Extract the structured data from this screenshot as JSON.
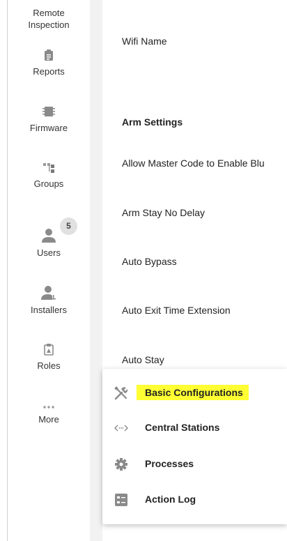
{
  "sidebar": {
    "items": [
      {
        "label_line1": "Remote",
        "label_line2": "Inspection",
        "icon": "remote-inspection-icon"
      },
      {
        "label": "Reports",
        "icon": "clipboard-icon"
      },
      {
        "label": "Firmware",
        "icon": "chip-icon"
      },
      {
        "label": "Groups",
        "icon": "groups-icon"
      },
      {
        "label": "Users",
        "icon": "user-icon",
        "badge": "5"
      },
      {
        "label": "Installers",
        "icon": "installer-icon"
      },
      {
        "label": "Roles",
        "icon": "roles-icon"
      },
      {
        "label": "More",
        "icon": "more-dots-icon"
      }
    ]
  },
  "main": {
    "wifi_name": "Wifi Name",
    "section_title": "Arm Settings",
    "settings": [
      "Allow Master Code to Enable Blu",
      "Arm Stay No Delay",
      "Auto Bypass",
      "Auto Exit Time Extension",
      "Auto Stay"
    ]
  },
  "popup": {
    "items": [
      {
        "label": "Basic Configurations",
        "icon": "tools-icon",
        "highlighted": true
      },
      {
        "label": "Central Stations",
        "icon": "code-brackets-icon"
      },
      {
        "label": "Processes",
        "icon": "gear-icon"
      },
      {
        "label": "Action Log",
        "icon": "list-icon"
      }
    ]
  },
  "colors": {
    "highlight": "#ffff33",
    "icon_gray": "#8a8a8a",
    "gutter": "#f2f2f2"
  }
}
